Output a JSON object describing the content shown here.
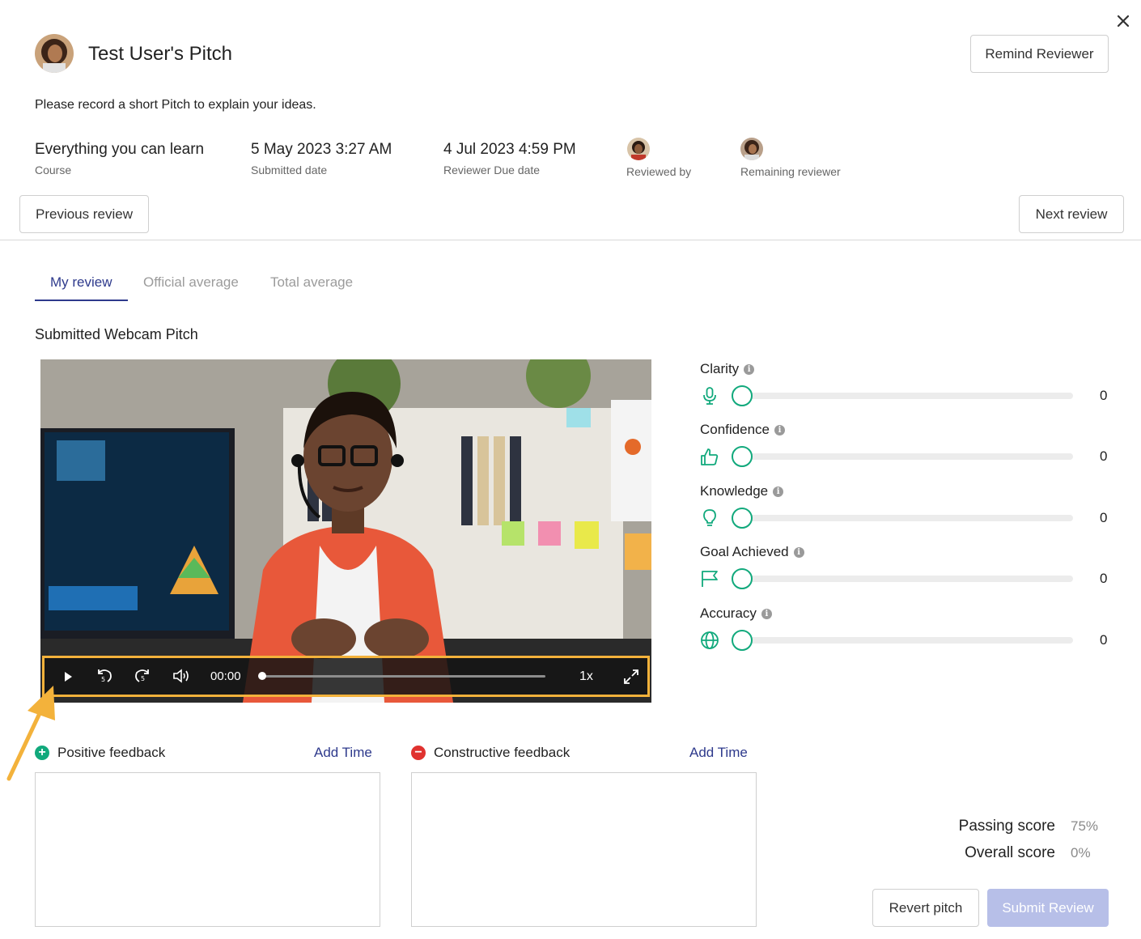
{
  "header": {
    "title": "Test User's Pitch",
    "remind_label": "Remind Reviewer",
    "description": "Please record a short Pitch to explain your ideas."
  },
  "meta": {
    "course_value": "Everything you can learn",
    "course_label": "Course",
    "submitted_value": "5 May 2023 3:27 AM",
    "submitted_label": "Submitted date",
    "due_value": "4 Jul 2023 4:59 PM",
    "due_label": "Reviewer Due date",
    "reviewed_by_label": "Reviewed by",
    "remaining_label": "Remaining reviewer"
  },
  "nav": {
    "previous_label": "Previous review",
    "next_label": "Next review"
  },
  "tabs": [
    {
      "label": "My review",
      "active": true
    },
    {
      "label": "Official average",
      "active": false
    },
    {
      "label": "Total average",
      "active": false
    }
  ],
  "section_title": "Submitted Webcam Pitch",
  "video": {
    "time": "00:00",
    "speed": "1x",
    "progress": 0
  },
  "sliders": [
    {
      "label": "Clarity",
      "icon": "microphone-icon",
      "value": "0"
    },
    {
      "label": "Confidence",
      "icon": "thumbs-up-icon",
      "value": "0"
    },
    {
      "label": "Knowledge",
      "icon": "lightbulb-icon",
      "value": "0"
    },
    {
      "label": "Goal Achieved",
      "icon": "flag-icon",
      "value": "0"
    },
    {
      "label": "Accuracy",
      "icon": "globe-icon",
      "value": "0"
    }
  ],
  "feedback": {
    "positive_label": "Positive feedback",
    "constructive_label": "Constructive feedback",
    "add_time_label": "Add Time"
  },
  "scores": {
    "passing_label": "Passing score",
    "passing_value": "75%",
    "overall_label": "Overall score",
    "overall_value": "0%"
  },
  "actions": {
    "revert_label": "Revert pitch",
    "submit_label": "Submit Review"
  },
  "colors": {
    "accent": "#2e3a8c",
    "slider_green": "#11a97c",
    "highlight": "#f3b23b",
    "positive": "#11a97c",
    "negative": "#e0322f"
  }
}
